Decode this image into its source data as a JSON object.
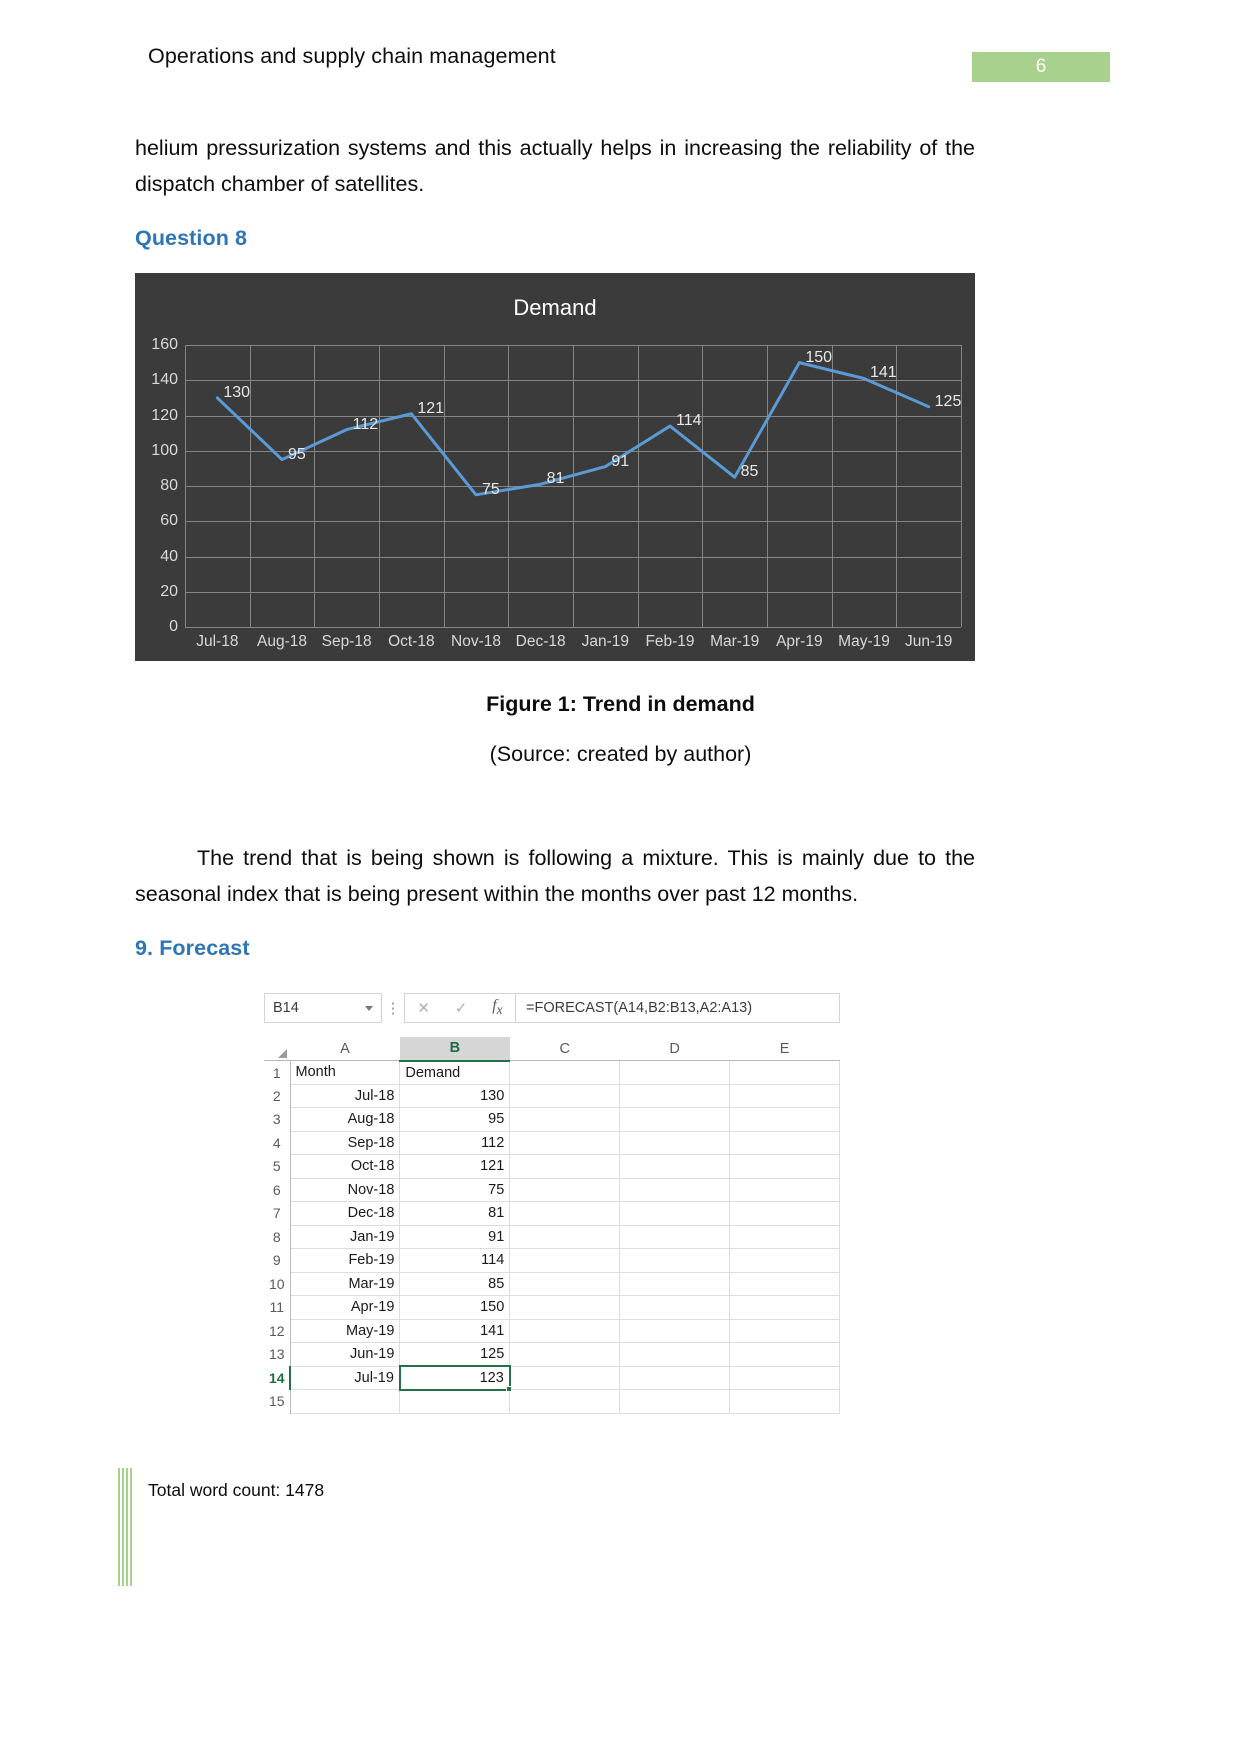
{
  "header": {
    "title": "Operations and supply chain management",
    "page_number": "6",
    "badge_color": "#a9d18e"
  },
  "body": {
    "paragraph_1": "helium pressurization systems and this actually helps in increasing the reliability of the dispatch chamber of satellites.",
    "paragraph_2": "The trend that is being shown is following a mixture. This is mainly due to the seasonal index that is being present within the months over past 12 months.",
    "heading_question_8": "Question 8",
    "heading_forecast": "9. Forecast",
    "heading_color": "#2e75b6"
  },
  "figure": {
    "caption": "Figure 1: Trend in demand",
    "source": "(Source: created by author)"
  },
  "chart_data": {
    "type": "line",
    "title": "Demand",
    "categories": [
      "Jul-18",
      "Aug-18",
      "Sep-18",
      "Oct-18",
      "Nov-18",
      "Dec-18",
      "Jan-19",
      "Feb-19",
      "Mar-19",
      "Apr-19",
      "May-19",
      "Jun-19"
    ],
    "values": [
      130,
      95,
      112,
      121,
      75,
      81,
      91,
      114,
      85,
      150,
      141,
      125
    ],
    "data_labels": [
      "130",
      "95",
      "112",
      "121",
      "75",
      "81",
      "91",
      "114",
      "85",
      "150",
      "141",
      "125"
    ],
    "ylabel": "",
    "xlabel": "",
    "ylim": [
      0,
      160
    ],
    "yticks": [
      0,
      20,
      40,
      60,
      80,
      100,
      120,
      140,
      160
    ],
    "grid": true,
    "legend": "none",
    "series_color": "#5b9bd5",
    "plot_background": "#3b3b3b",
    "text_color": "#d9d9d9"
  },
  "excel": {
    "name_box": "B14",
    "cancel_icon": "close-icon",
    "confirm_icon": "check-icon",
    "function_icon": "fx-icon",
    "formula": "=FORECAST(A14,B2:B13,A2:A13)",
    "columns": [
      "A",
      "B",
      "C",
      "D",
      "E"
    ],
    "selected_column": "B",
    "selected_row": "14",
    "rows": [
      {
        "num": "1",
        "a": "Month",
        "b": "Demand",
        "a_align": "left",
        "b_align": "left"
      },
      {
        "num": "2",
        "a": "Jul-18",
        "b": "130"
      },
      {
        "num": "3",
        "a": "Aug-18",
        "b": "95"
      },
      {
        "num": "4",
        "a": "Sep-18",
        "b": "112"
      },
      {
        "num": "5",
        "a": "Oct-18",
        "b": "121"
      },
      {
        "num": "6",
        "a": "Nov-18",
        "b": "75"
      },
      {
        "num": "7",
        "a": "Dec-18",
        "b": "81"
      },
      {
        "num": "8",
        "a": "Jan-19",
        "b": "91"
      },
      {
        "num": "9",
        "a": "Feb-19",
        "b": "114"
      },
      {
        "num": "10",
        "a": "Mar-19",
        "b": "85"
      },
      {
        "num": "11",
        "a": "Apr-19",
        "b": "150"
      },
      {
        "num": "12",
        "a": "May-19",
        "b": "141"
      },
      {
        "num": "13",
        "a": "Jun-19",
        "b": "125"
      },
      {
        "num": "14",
        "a": "Jul-19",
        "b": "123",
        "selected": true
      },
      {
        "num": "15",
        "a": "",
        "b": ""
      }
    ]
  },
  "footer": {
    "word_count": "Total word count: 1478"
  }
}
